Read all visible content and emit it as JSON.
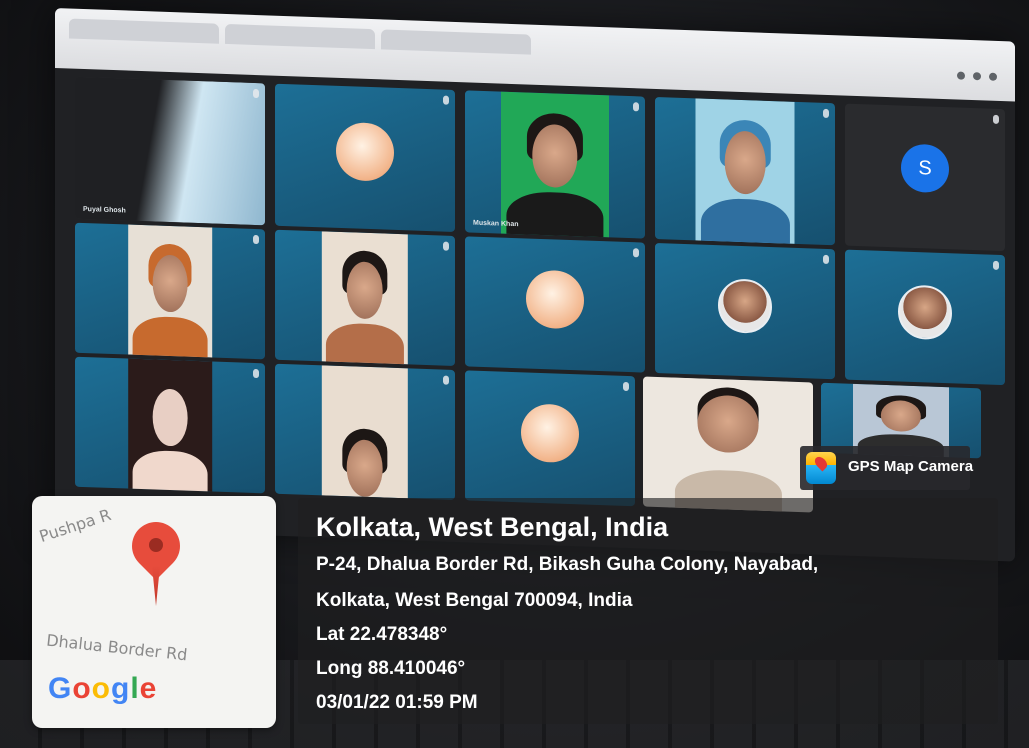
{
  "meeting": {
    "participants": [
      {
        "name": "Puyal Ghosh",
        "kind": "video-light"
      },
      {
        "name": "",
        "kind": "avatar-circle"
      },
      {
        "name": "Muskan Khan",
        "kind": "video-person-green"
      },
      {
        "name": "",
        "kind": "video-person-blue"
      },
      {
        "name": "",
        "kind": "avatar-letter",
        "letter": "S"
      },
      {
        "name": "",
        "kind": "video-person-hijab"
      },
      {
        "name": "",
        "kind": "video-person"
      },
      {
        "name": "",
        "kind": "avatar-circle"
      },
      {
        "name": "",
        "kind": "avatar-photo"
      },
      {
        "name": "",
        "kind": "avatar-photo"
      },
      {
        "name": "",
        "kind": "video-person-dark"
      },
      {
        "name": "",
        "kind": "video-person-partial"
      },
      {
        "name": "",
        "kind": "avatar-circle"
      },
      {
        "name": "",
        "kind": "video-person-large"
      },
      {
        "name": "",
        "kind": "video-person-small"
      }
    ]
  },
  "map_thumb": {
    "top_label": "Pushpa R",
    "road_label": "Dhalua Border Rd",
    "google_letters": [
      {
        "ch": "G",
        "color": "#4285F4"
      },
      {
        "ch": "o",
        "color": "#EA4335"
      },
      {
        "ch": "o",
        "color": "#FBBC05"
      },
      {
        "ch": "g",
        "color": "#4285F4"
      },
      {
        "ch": "l",
        "color": "#34A853"
      },
      {
        "ch": "e",
        "color": "#EA4335"
      }
    ]
  },
  "gps_badge": {
    "label": "GPS Map Camera"
  },
  "location": {
    "title": "Kolkata, West Bengal, India",
    "address_line1": "P-24, Dhalua Border Rd, Bikash Guha Colony, Nayabad,",
    "address_line2": "Kolkata, West Bengal 700094, India",
    "lat": "Lat 22.478348°",
    "long": "Long 88.410046°",
    "datetime": "03/01/22 01:59 PM"
  }
}
